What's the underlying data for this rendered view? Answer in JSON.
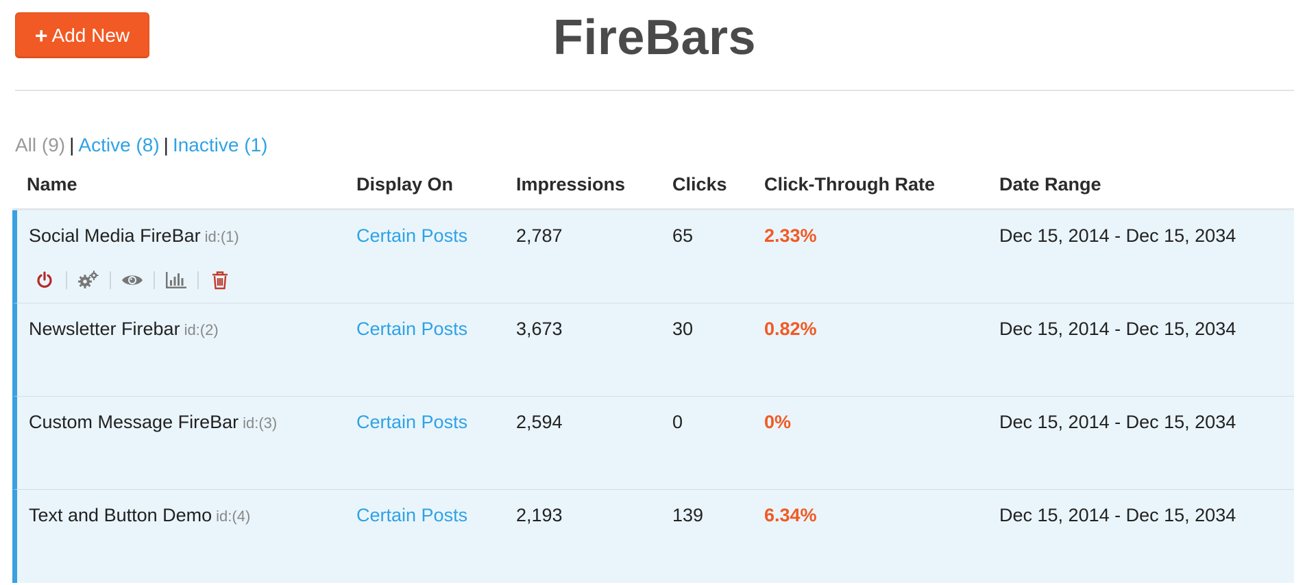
{
  "header": {
    "add_button_label": "Add New",
    "title": "FireBars"
  },
  "filters": {
    "all": "All (9)",
    "active": "Active (8)",
    "inactive": "Inactive (1)",
    "separator": "|"
  },
  "table": {
    "columns": {
      "name": "Name",
      "display_on": "Display On",
      "impressions": "Impressions",
      "clicks": "Clicks",
      "ctr": "Click-Through Rate",
      "date_range": "Date Range"
    },
    "rows": [
      {
        "name": "Social Media FireBar",
        "id": "id:(1)",
        "display_on": "Certain Posts",
        "impressions": "2,787",
        "clicks": "65",
        "ctr": "2.33%",
        "date_range": "Dec 15, 2014 - Dec 15, 2034"
      },
      {
        "name": "Newsletter Firebar",
        "id": "id:(2)",
        "display_on": "Certain Posts",
        "impressions": "3,673",
        "clicks": "30",
        "ctr": "0.82%",
        "date_range": "Dec 15, 2014 - Dec 15, 2034"
      },
      {
        "name": "Custom Message FireBar",
        "id": "id:(3)",
        "display_on": "Certain Posts",
        "impressions": "2,594",
        "clicks": "0",
        "ctr": "0%",
        "date_range": "Dec 15, 2014 - Dec 15, 2034"
      },
      {
        "name": "Text and Button Demo",
        "id": "id:(4)",
        "display_on": "Certain Posts",
        "impressions": "2,193",
        "clicks": "139",
        "ctr": "6.34%",
        "date_range": "Dec 15, 2014 - Dec 15, 2034"
      }
    ],
    "row_actions": [
      "power-icon",
      "gears-icon",
      "eye-icon",
      "bar-chart-icon",
      "trash-icon"
    ]
  },
  "colors": {
    "accent": "#f15a24",
    "link": "#2ea2e6",
    "row_bg": "#eaf5fb",
    "row_border": "#3aa0e0",
    "power_icon": "#b52a2a",
    "trash_icon": "#c0392b",
    "neutral_icon": "#777777"
  }
}
